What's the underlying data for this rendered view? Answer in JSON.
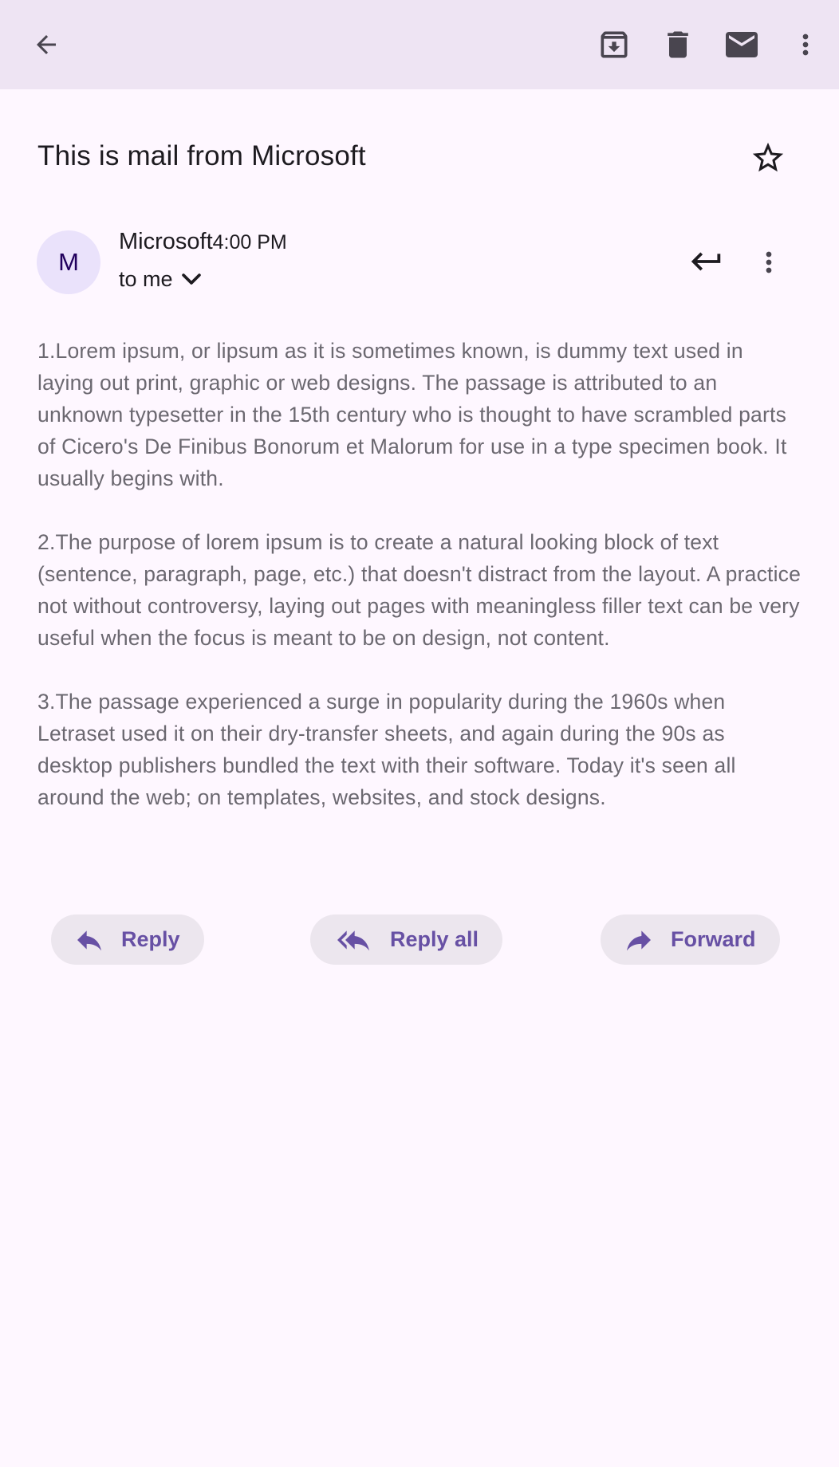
{
  "toolbar": {
    "back_icon": "arrow-back-icon",
    "archive_icon": "archive-icon",
    "delete_icon": "trash-icon",
    "mark_unread_icon": "mail-icon",
    "more_icon": "more-vert-icon"
  },
  "email": {
    "subject": "This is mail from Microsoft",
    "starred": false,
    "sender": {
      "avatar_letter": "M",
      "name": "Microsoft",
      "time": "4:00 PM",
      "recipients": "to me"
    },
    "body": [
      "1.Lorem ipsum, or lipsum as it is sometimes known, is dummy text used in laying out print, graphic or web designs. The passage is attributed to an unknown typesetter in the 15th century who is thought to have scrambled parts of Cicero's De Finibus Bonorum et Malorum for use in a type specimen book. It usually begins with.",
      "2.The purpose of lorem ipsum is to create a natural looking block of text (sentence, paragraph, page, etc.) that doesn't distract from the layout. A practice not without controversy, laying out pages with meaningless filler text can be very useful when the focus is meant to be on design, not content.",
      "3.The passage experienced a surge in popularity during the 1960s when Letraset used it on their dry-transfer sheets, and again during the 90s as desktop publishers bundled the text with their software. Today it's seen all around the web; on templates, websites, and stock designs."
    ]
  },
  "actions": {
    "reply": "Reply",
    "reply_all": "Reply all",
    "forward": "Forward"
  },
  "colors": {
    "background": "#FEF7FF",
    "topbar": "#EEE4F3",
    "accent": "#6750A4",
    "avatar_bg": "#EAE2FB",
    "button_bg": "#ECE6EE",
    "body_text": "#6B6870"
  }
}
